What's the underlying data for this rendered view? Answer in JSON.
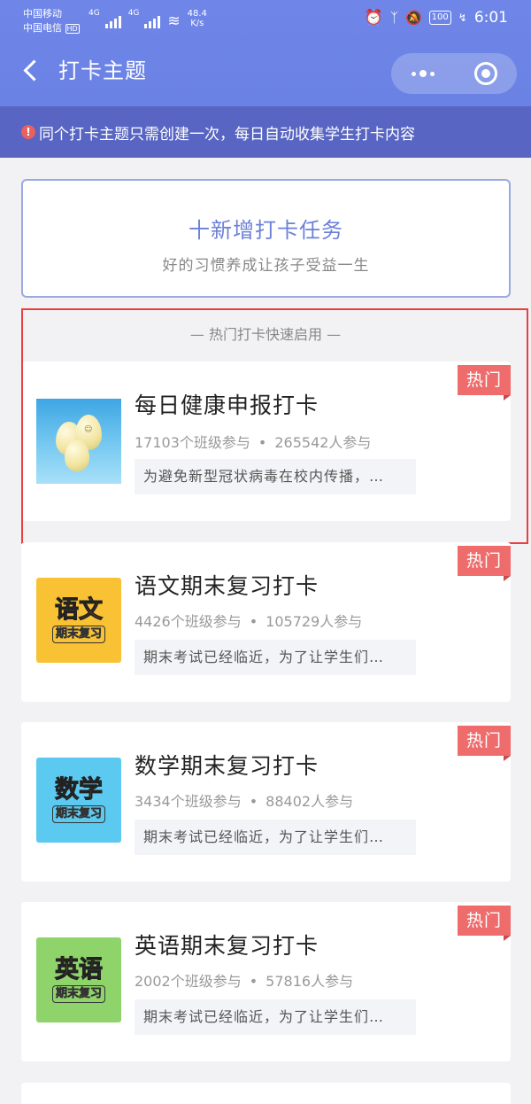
{
  "status_bar": {
    "carrier1": "中国移动",
    "carrier2": "中国电信",
    "hd": "HD",
    "net1": "4G",
    "net2": "4G",
    "speed_value": "48.4",
    "speed_unit": "K/s",
    "battery": "100",
    "time": "6:01"
  },
  "nav": {
    "title": "打卡主题"
  },
  "notice": {
    "text": "同个打卡主题只需创建一次，每日自动收集学生打卡内容"
  },
  "add_task": {
    "title": "十新增打卡任务",
    "subtitle": "好的习惯养成让孩子受益一生"
  },
  "hot_section": {
    "label": "— 热门打卡快速启用 —"
  },
  "colors": {
    "header": "#6f86e8",
    "notice_bg": "#5865c2",
    "hot_tag": "#ef6c6c",
    "highlight_box": "#e64040"
  },
  "cards": [
    {
      "title": "每日健康申报打卡",
      "classes": "17103个班级参与",
      "people": "265542人参与",
      "desc": "为避免新型冠状病毒在校内传播，…",
      "tag": "热门",
      "thumb": "balloons"
    },
    {
      "title": "语文期末复习打卡",
      "classes": "4426个班级参与",
      "people": "105729人参与",
      "desc": "期末考试已经临近，为了让学生们…",
      "tag": "热门",
      "thumb_big": "语文",
      "thumb_small": "期末复习",
      "thumb_color": "#f8c234"
    },
    {
      "title": "数学期末复习打卡",
      "classes": "3434个班级参与",
      "people": "88402人参与",
      "desc": "期末考试已经临近，为了让学生们…",
      "tag": "热门",
      "thumb_big": "数学",
      "thumb_small": "期末复习",
      "thumb_color": "#5ccaf0"
    },
    {
      "title": "英语期末复习打卡",
      "classes": "2002个班级参与",
      "people": "57816人参与",
      "desc": "期末考试已经临近，为了让学生们…",
      "tag": "热门",
      "thumb_big": "英语",
      "thumb_small": "期末复习",
      "thumb_color": "#8fd46b"
    }
  ]
}
